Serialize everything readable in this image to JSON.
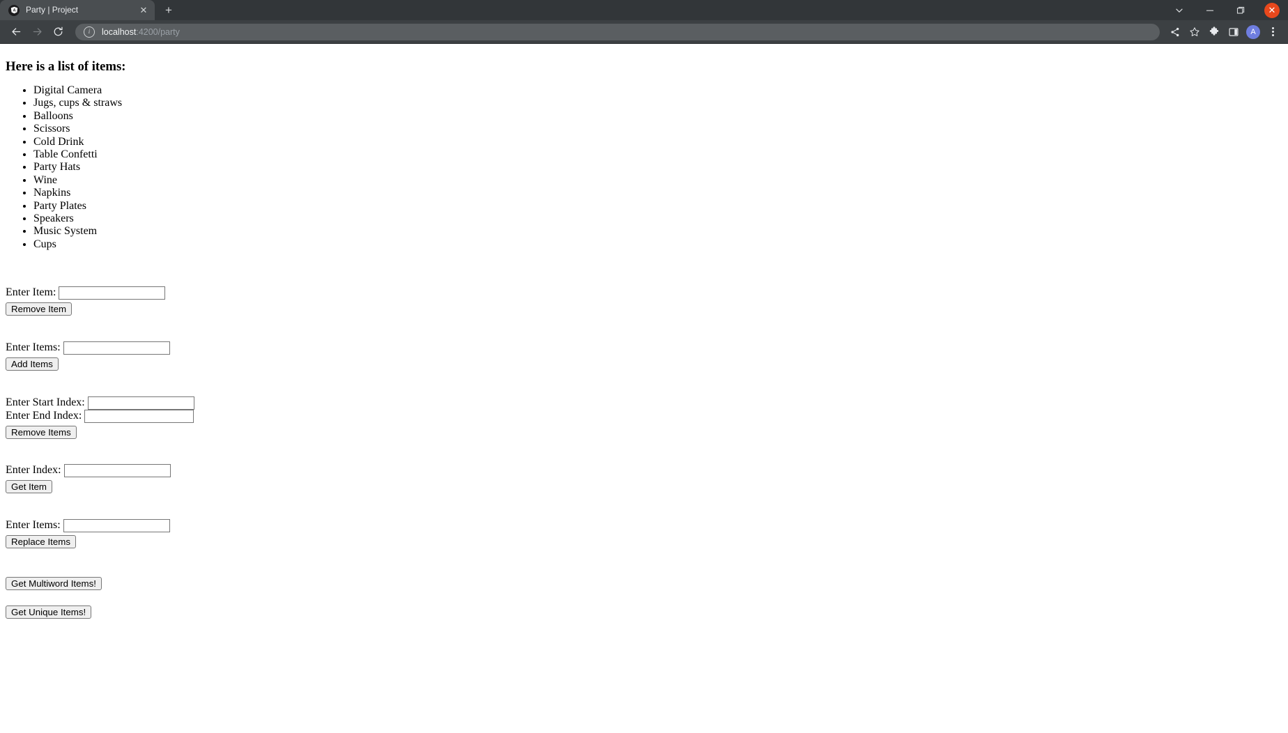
{
  "browser": {
    "tab": {
      "title": "Party | Project",
      "favicon": "angular-icon",
      "close_label": "✕"
    },
    "new_tab_label": "+",
    "window_controls": {
      "expand_label": "⌄",
      "minimize_label": "—",
      "maximize_label": "❐",
      "close_label": "✕"
    },
    "toolbar": {
      "back_label": "←",
      "forward_label": "→",
      "reload_label": "⟳",
      "info_label": "i",
      "url_host": "localhost",
      "url_rest": ":4200/party",
      "share_label": "share-icon",
      "bookmark_label": "☆",
      "extensions_label": "puzzle-icon",
      "sidepanel_label": "side-panel-icon",
      "profile_initial": "A",
      "menu_label": "kebab-menu-icon"
    }
  },
  "page": {
    "heading": "Here is a list of items:",
    "items": [
      "Digital Camera",
      "Jugs, cups & straws",
      "Balloons",
      "Scissors",
      "Cold Drink",
      "Table Confetti",
      "Party Hats",
      "Wine",
      "Napkins",
      "Party Plates",
      "Speakers",
      "Music System",
      "Cups"
    ],
    "forms": {
      "remove_item": {
        "label": "Enter Item:",
        "input_value": "",
        "button": "Remove Item"
      },
      "add_items": {
        "label": "Enter Items:",
        "input_value": "",
        "button": "Add Items"
      },
      "remove_range": {
        "start_label": "Enter Start Index:",
        "start_value": "",
        "end_label": "Enter End Index:",
        "end_value": "",
        "button": "Remove Items"
      },
      "get_item": {
        "label": "Enter Index:",
        "input_value": "",
        "button": "Get Item"
      },
      "replace_items": {
        "label": "Enter Items:",
        "input_value": "",
        "button": "Replace Items"
      },
      "multiword": {
        "button": "Get Multiword Items!"
      },
      "unique": {
        "button": "Get Unique Items!"
      }
    }
  },
  "colors": {
    "tabstrip_bg": "#323639",
    "tab_active_bg": "#4a4e51",
    "toolbar_bg": "#3c4043",
    "omnibox_bg": "#5a5e61",
    "close_red": "#e8481c",
    "avatar_purple": "#6f7ee0"
  }
}
